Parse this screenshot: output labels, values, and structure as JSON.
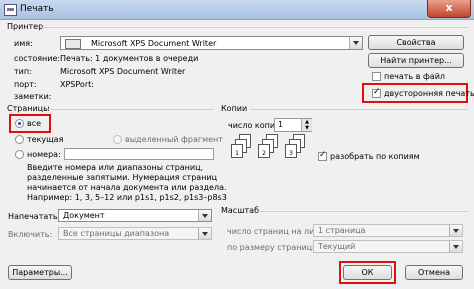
{
  "window": {
    "title": "Печать",
    "close_label": "x"
  },
  "printer": {
    "group_label": "Принтер",
    "name_label": "имя:",
    "name_value": "Microsoft XPS Document Writer",
    "properties_button": "Свойства",
    "state_label": "состояние:",
    "state_value": "Печать: 1 документов в очереди",
    "find_button": "Найти принтер...",
    "type_label": "тип:",
    "type_value": "Microsoft XPS Document Writer",
    "port_label": "порт:",
    "port_value": "XPSPort:",
    "notes_label": "заметки:",
    "print_to_file_label": "печать в файл",
    "print_to_file_checked": false,
    "duplex_label": "двусторонняя печать",
    "duplex_checked": true
  },
  "pages": {
    "group_label": "Страницы",
    "all_label": "все",
    "current_label": "текущая",
    "selection_label": "выделенный фрагмент",
    "numbers_label": "номера:",
    "numbers_value": "",
    "hint_lines": [
      "Введите номера или диапазоны страниц,",
      "разделенные запятыми. Нумерация страниц",
      "начинается от начала документа или раздела.",
      "Например: 1, 3, 5–12 или p1s1, p1s2, p1s3–p8s3"
    ]
  },
  "copies": {
    "group_label": "Копии",
    "count_label": "число копий:",
    "count_value": "1",
    "collate_label": "разобрать по копиям",
    "collate_checked": true,
    "page_numbers": [
      "1",
      "2",
      "3"
    ]
  },
  "print_what": {
    "label": "Напечатать:",
    "value": "Документ"
  },
  "include": {
    "label": "Включить:",
    "value": "Все страницы диапазона"
  },
  "scale": {
    "group_label": "Масштаб",
    "pages_per_sheet_label": "число страниц на листе:",
    "pages_per_sheet_value": "1 страница",
    "fit_label": "по размеру страницы:",
    "fit_value": "Текущий"
  },
  "footer": {
    "options_button": "Параметры...",
    "ok_button": "ОК",
    "cancel_button": "Отмена"
  },
  "colors": {
    "highlight": "#e01010",
    "title_bar": "#b8cde9",
    "close_button": "#c3452c"
  }
}
